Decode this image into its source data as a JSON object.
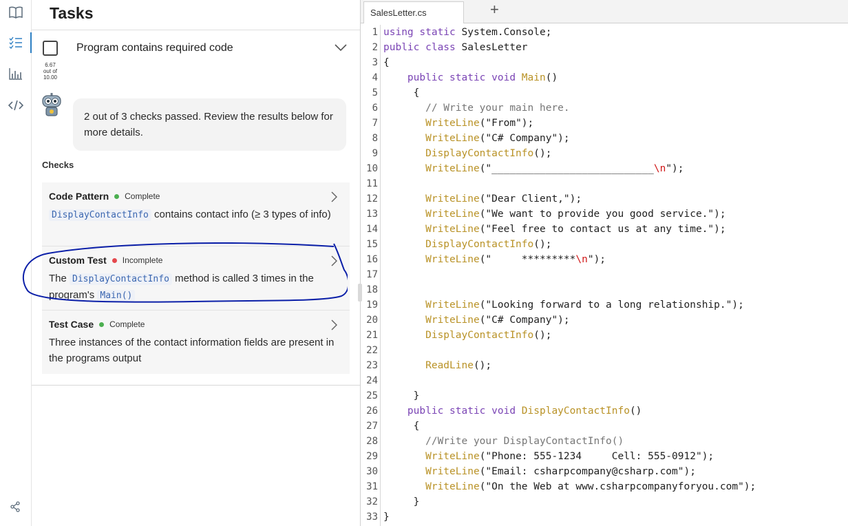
{
  "panel": {
    "title": "Tasks",
    "task": {
      "label": "Program contains required code",
      "score": "6.67",
      "score_sep": "out of",
      "score_max": "10.00"
    },
    "bubble": "2 out of 3 checks passed. Review the results below for more details.",
    "checks_heading": "Checks",
    "checks": [
      {
        "name": "Code Pattern",
        "status": "Complete",
        "status_color": "#4caf50",
        "code": "DisplayContactInfo",
        "desc_after": " contains contact info (≥ 3 types of info)"
      },
      {
        "name": "Custom Test",
        "status": "Incomplete",
        "status_color": "#e5484d",
        "desc_before": "The ",
        "code": "DisplayContactInfo",
        "desc_mid": " method is called 3 times in the program's ",
        "code2": "Main()"
      },
      {
        "name": "Test Case",
        "status": "Complete",
        "status_color": "#4caf50",
        "desc": "Three instances of the contact information fields are present in the programs output"
      }
    ]
  },
  "editor": {
    "tab": "SalesLetter.cs",
    "add_tab": "+",
    "lines": [
      [
        [
          "kw",
          "using static "
        ],
        [
          "p",
          "System.Console;"
        ]
      ],
      [
        [
          "kw",
          "public class "
        ],
        [
          "p",
          "SalesLetter"
        ]
      ],
      [
        [
          "p",
          "{"
        ]
      ],
      [
        [
          "p",
          "    "
        ],
        [
          "kw",
          "public static void "
        ],
        [
          "fn",
          "Main"
        ],
        [
          "p",
          "()"
        ]
      ],
      [
        [
          "p",
          "     {"
        ]
      ],
      [
        [
          "p",
          "       "
        ],
        [
          "cm",
          "// Write your main here."
        ]
      ],
      [
        [
          "p",
          "       "
        ],
        [
          "fn",
          "WriteLine"
        ],
        [
          "p",
          "(\"From\");"
        ]
      ],
      [
        [
          "p",
          "       "
        ],
        [
          "fn",
          "WriteLine"
        ],
        [
          "p",
          "(\"C# Company\");"
        ]
      ],
      [
        [
          "p",
          "       "
        ],
        [
          "fn",
          "DisplayContactInfo"
        ],
        [
          "p",
          "();"
        ]
      ],
      [
        [
          "p",
          "       "
        ],
        [
          "fn",
          "WriteLine"
        ],
        [
          "p",
          "(\"___________________________"
        ],
        [
          "esc",
          "\\n"
        ],
        [
          "p",
          "\");"
        ]
      ],
      [
        [
          "p",
          ""
        ]
      ],
      [
        [
          "p",
          "       "
        ],
        [
          "fn",
          "WriteLine"
        ],
        [
          "p",
          "(\"Dear Client,\");"
        ]
      ],
      [
        [
          "p",
          "       "
        ],
        [
          "fn",
          "WriteLine"
        ],
        [
          "p",
          "(\"We want to provide you good service.\");"
        ]
      ],
      [
        [
          "p",
          "       "
        ],
        [
          "fn",
          "WriteLine"
        ],
        [
          "p",
          "(\"Feel free to contact us at any time.\");"
        ]
      ],
      [
        [
          "p",
          "       "
        ],
        [
          "fn",
          "DisplayContactInfo"
        ],
        [
          "p",
          "();"
        ]
      ],
      [
        [
          "p",
          "       "
        ],
        [
          "fn",
          "WriteLine"
        ],
        [
          "p",
          "(\"     *********"
        ],
        [
          "esc",
          "\\n"
        ],
        [
          "p",
          "\");"
        ]
      ],
      [
        [
          "p",
          ""
        ]
      ],
      [
        [
          "p",
          ""
        ]
      ],
      [
        [
          "p",
          "       "
        ],
        [
          "fn",
          "WriteLine"
        ],
        [
          "p",
          "(\"Looking forward to a long relationship.\");"
        ]
      ],
      [
        [
          "p",
          "       "
        ],
        [
          "fn",
          "WriteLine"
        ],
        [
          "p",
          "(\"C# Company\");"
        ]
      ],
      [
        [
          "p",
          "       "
        ],
        [
          "fn",
          "DisplayContactInfo"
        ],
        [
          "p",
          "();"
        ]
      ],
      [
        [
          "p",
          ""
        ]
      ],
      [
        [
          "p",
          "       "
        ],
        [
          "fn",
          "ReadLine"
        ],
        [
          "p",
          "();"
        ]
      ],
      [
        [
          "p",
          ""
        ]
      ],
      [
        [
          "p",
          "     }"
        ]
      ],
      [
        [
          "p",
          "    "
        ],
        [
          "kw",
          "public static void "
        ],
        [
          "fn",
          "DisplayContactInfo"
        ],
        [
          "p",
          "()"
        ]
      ],
      [
        [
          "p",
          "     {"
        ]
      ],
      [
        [
          "p",
          "       "
        ],
        [
          "cm",
          "//Write your DisplayContactInfo()"
        ]
      ],
      [
        [
          "p",
          "       "
        ],
        [
          "fn",
          "WriteLine"
        ],
        [
          "p",
          "(\"Phone: 555-1234     Cell: 555-0912\");"
        ]
      ],
      [
        [
          "p",
          "       "
        ],
        [
          "fn",
          "WriteLine"
        ],
        [
          "p",
          "(\"Email: csharpcompany@csharp.com\");"
        ]
      ],
      [
        [
          "p",
          "       "
        ],
        [
          "fn",
          "WriteLine"
        ],
        [
          "p",
          "(\"On the Web at www.csharpcompanyforyou.com\");"
        ]
      ],
      [
        [
          "p",
          "     }"
        ]
      ],
      [
        [
          "p",
          "}"
        ]
      ]
    ]
  },
  "colors": {
    "accent": "#2d7fc3",
    "complete": "#4caf50",
    "incomplete": "#e5484d",
    "annotation": "#0b1fa8"
  },
  "icons": [
    "book-icon",
    "task-list-icon",
    "bar-chart-icon",
    "code-icon",
    "share-icon",
    "chevron-down-icon",
    "chevron-right-icon",
    "robot-icon"
  ]
}
